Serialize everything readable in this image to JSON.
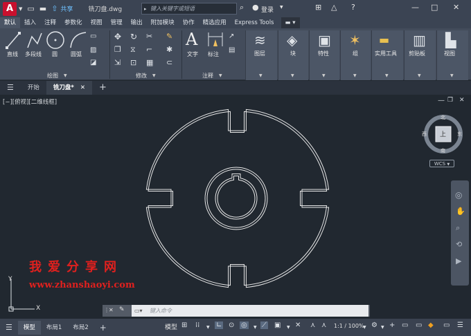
{
  "titlebar": {
    "app_letter": "A",
    "share": "共享",
    "filename": "铣刀盘.dwg",
    "search_placeholder": "键入关键字或短语",
    "login": "登录"
  },
  "ribbon_tabs": [
    "默认",
    "插入",
    "注释",
    "参数化",
    "视图",
    "管理",
    "输出",
    "附加模块",
    "协作",
    "精选应用",
    "Express Tools"
  ],
  "active_tab": "默认",
  "ribbon": {
    "draw": {
      "line": "直线",
      "polyline": "多段线",
      "circle": "圆",
      "arc": "圆弧",
      "title": "绘图"
    },
    "modify": {
      "title": "修改"
    },
    "annotation": {
      "text": "文字",
      "dimension": "标注",
      "title": "注释"
    },
    "panels": {
      "layers": "图层",
      "block": "块",
      "properties": "特性",
      "group": "组",
      "utilities": "实用工具",
      "clipboard": "剪贴板",
      "view": "视图"
    }
  },
  "doc_tabs": {
    "start": "开始",
    "drawing": "铣刀盘*"
  },
  "canvas": {
    "view_label": "[−][俯视][二维线框]",
    "viewcube": {
      "top": "上",
      "north": "北",
      "south": "南",
      "east": "东",
      "west": "西",
      "wcs": "WCS"
    },
    "ucs": {
      "x": "X",
      "y": "Y"
    },
    "watermark_cn": "我爱分享网",
    "watermark_url": "www.zhanshaoyi.com"
  },
  "command": {
    "placeholder": "键入命令"
  },
  "statusbar": {
    "tabs": [
      "模型",
      "布局1",
      "布局2"
    ],
    "active": "模型",
    "model_label": "模型",
    "scale": "1:1 / 100%"
  },
  "colors": {
    "accent": "#c8102e",
    "canvas": "#212830",
    "ribbon": "#434c5b",
    "watermark": "#e0201e"
  }
}
